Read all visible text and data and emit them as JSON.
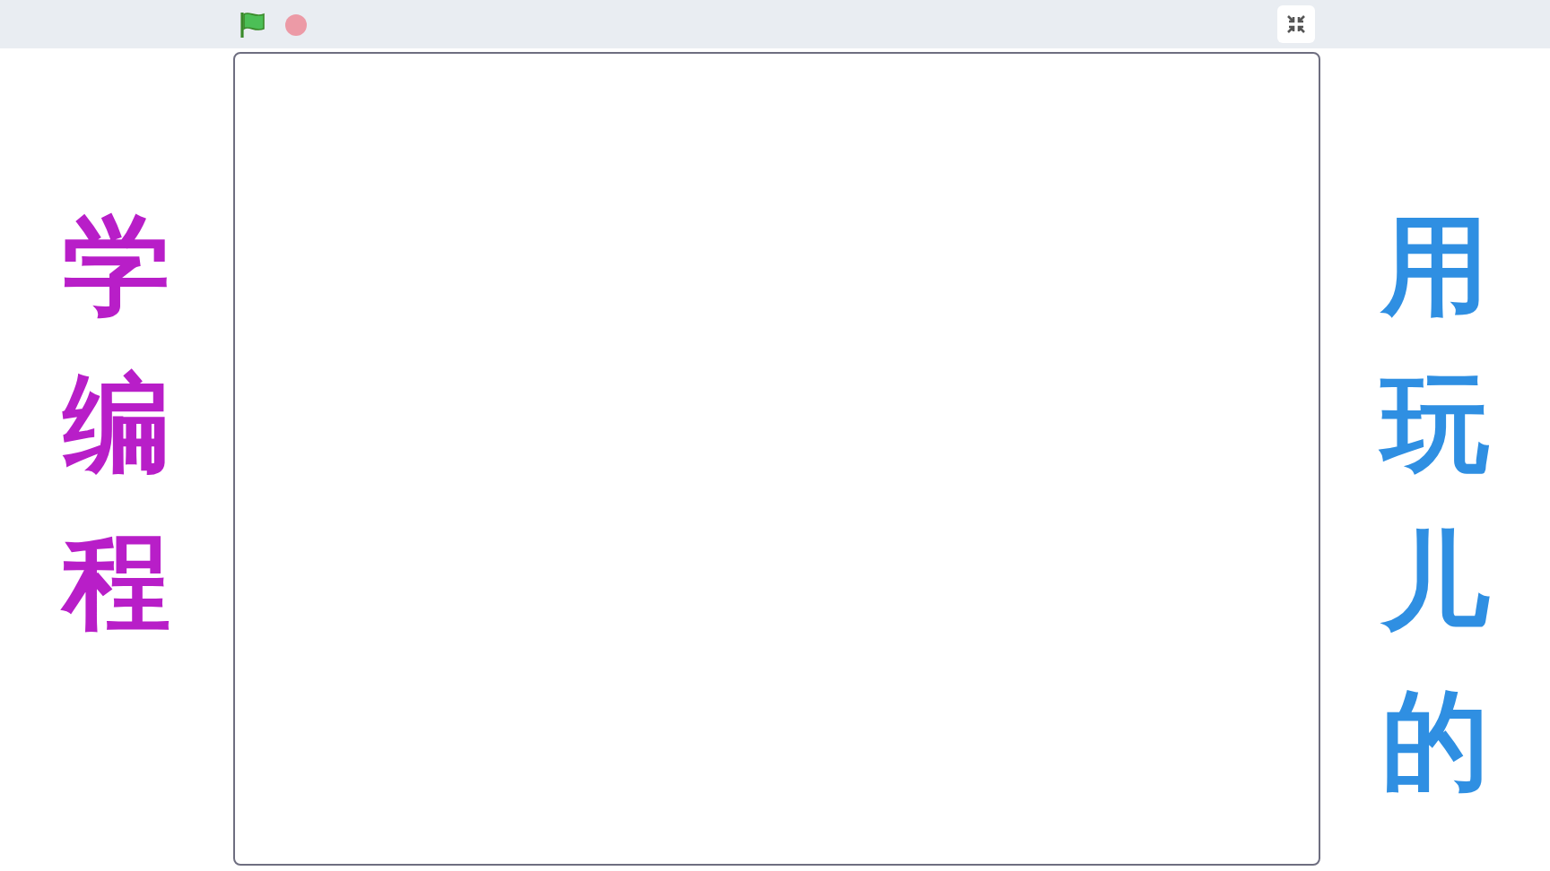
{
  "toolbar": {
    "buttons": [
      {
        "kind": "flag"
      },
      {
        "kind": "stop"
      }
    ],
    "fullscreen": {
      "kind": "unfullscreen"
    }
  },
  "left_caption": {
    "text": "学编程",
    "color": "#b81ec8"
  },
  "right_caption": {
    "text": "用玩儿的",
    "color": "#2f8fe2"
  }
}
